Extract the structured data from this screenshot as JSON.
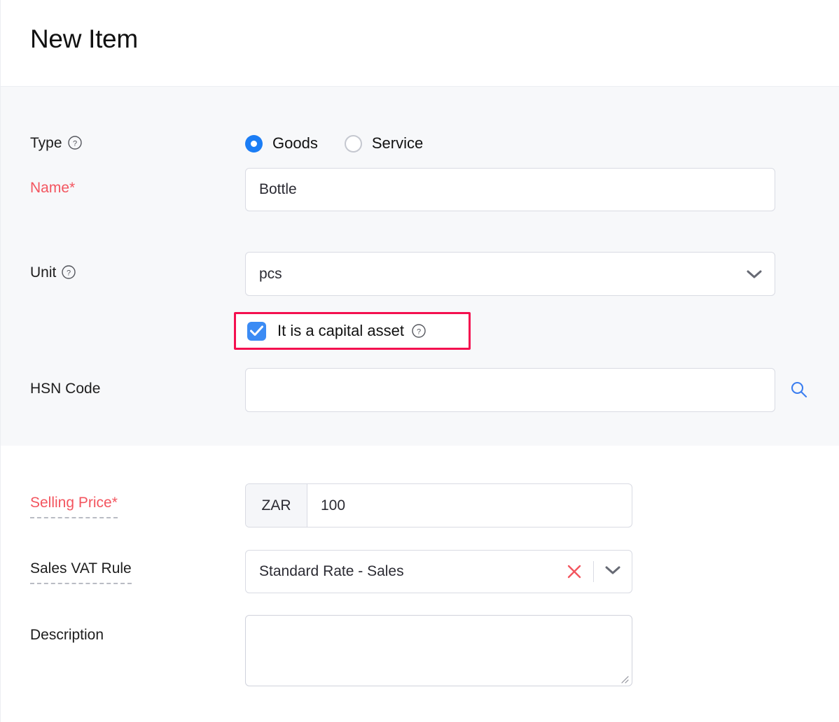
{
  "header": {
    "title": "New Item"
  },
  "form": {
    "type": {
      "label": "Type",
      "help_icon": "help-circle-icon",
      "options": [
        {
          "label": "Goods",
          "selected": true
        },
        {
          "label": "Service",
          "selected": false
        }
      ]
    },
    "name": {
      "label": "Name*",
      "value": "Bottle",
      "placeholder": "",
      "required": true
    },
    "unit": {
      "label": "Unit",
      "help_icon": "help-circle-icon",
      "value": "pcs",
      "dropdown_icon": "chevron-down-icon"
    },
    "capital_asset": {
      "label": "It is a capital asset",
      "checked": true,
      "help_icon": "help-circle-icon",
      "highlight_color": "#f4104f"
    },
    "hsn_code": {
      "label": "HSN Code",
      "value": "",
      "placeholder": "",
      "search_icon": "search-icon"
    },
    "selling_price": {
      "label": "Selling Price*",
      "currency": "ZAR",
      "value": "100",
      "required": true
    },
    "sales_vat_rule": {
      "label": "Sales VAT Rule",
      "value": "Standard Rate - Sales",
      "clear_icon": "close-x-icon",
      "dropdown_icon": "chevron-down-icon"
    },
    "description": {
      "label": "Description",
      "value": "",
      "placeholder": ""
    }
  },
  "colors": {
    "accent_blue": "#1b7df5",
    "required_red": "#f3555f",
    "highlight_pink": "#f4104f",
    "clear_red": "#f3555f",
    "panel_grey": "#f7f8fa"
  }
}
